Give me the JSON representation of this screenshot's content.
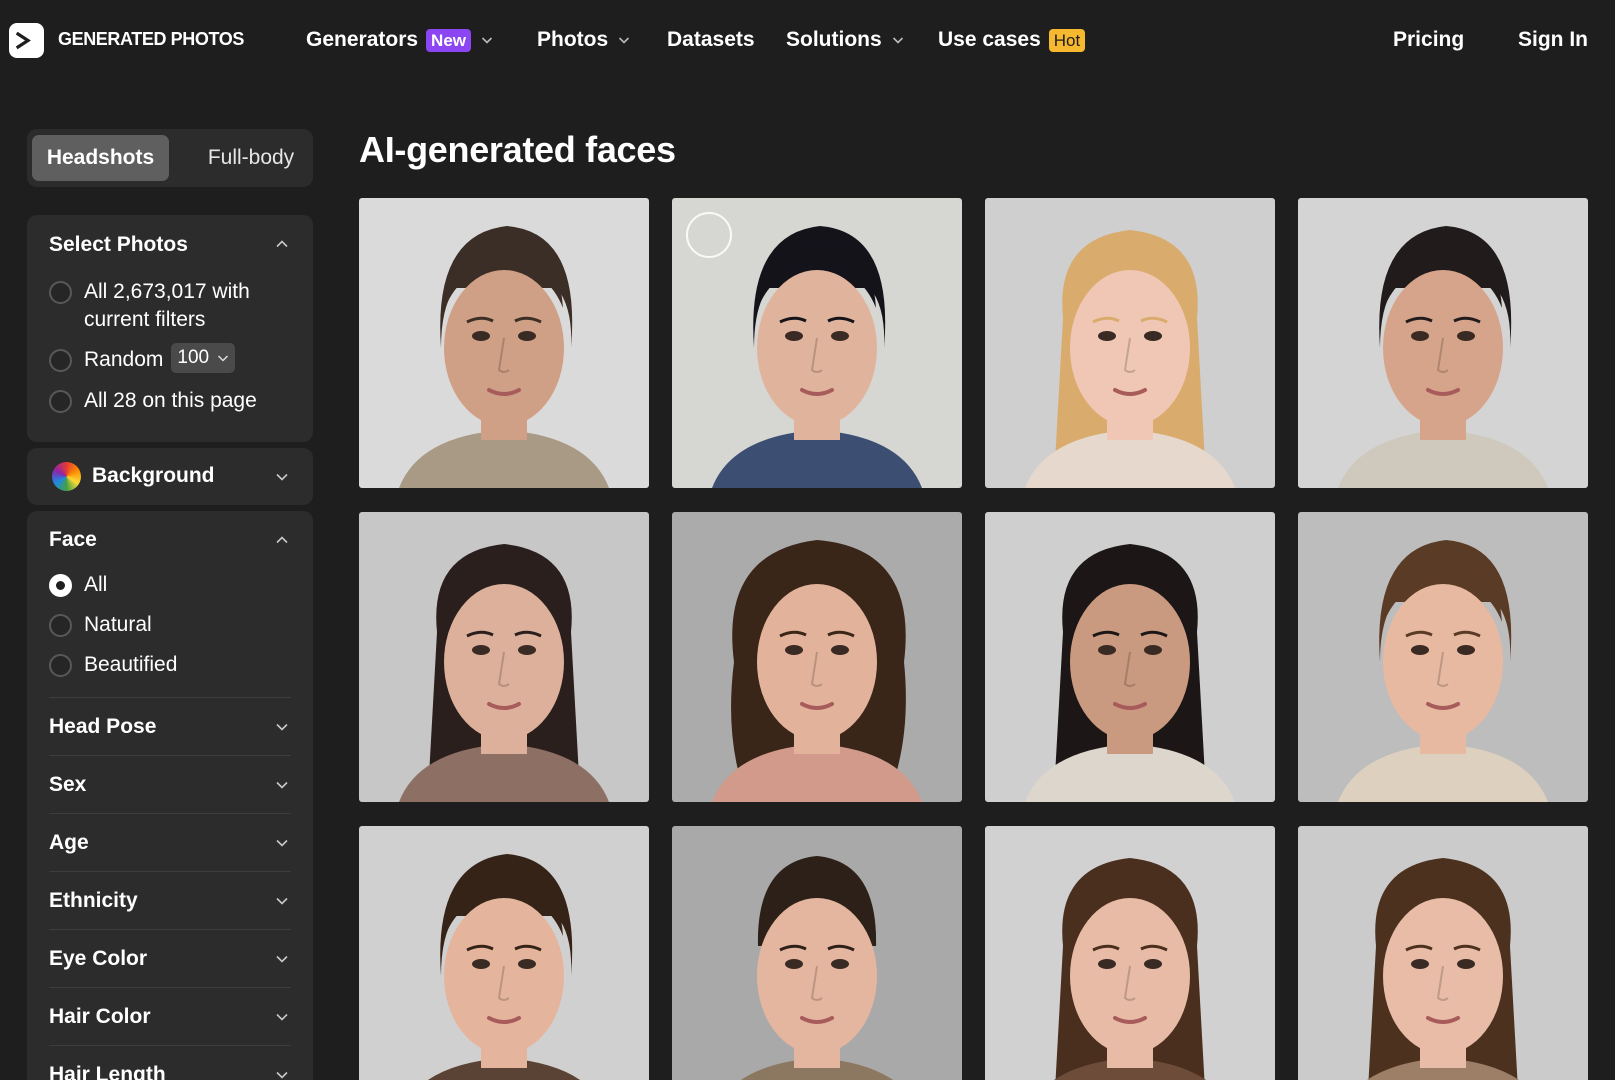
{
  "nav": {
    "brand": "GENERATED PHOTOS",
    "items": [
      {
        "label": "Generators",
        "badge": "New",
        "dropdown": true
      },
      {
        "label": "Photos",
        "badge": "",
        "dropdown": true
      },
      {
        "label": "Datasets",
        "badge": "",
        "dropdown": false
      },
      {
        "label": "Solutions",
        "badge": "",
        "dropdown": true
      },
      {
        "label": "Use cases",
        "badge": "Hot",
        "dropdown": false
      }
    ],
    "pricing": "Pricing",
    "sign_in": "Sign In",
    "logo_glyph": ">"
  },
  "sidebar": {
    "tabs": [
      "Headshots",
      "Full-body"
    ],
    "active_tab": "Headshots",
    "select_photos": {
      "title": "Select Photos",
      "opt_all": "All 2,673,017 with current filters",
      "opt_random": "Random",
      "random_count": "100",
      "opt_page": "All 28 on this page"
    },
    "background": {
      "title": "Background"
    },
    "face": {
      "title": "Face",
      "options": [
        "All",
        "Natural",
        "Beautified"
      ],
      "selected": "All"
    },
    "filters": [
      "Head Pose",
      "Sex",
      "Age",
      "Ethnicity",
      "Eye Color",
      "Hair Color",
      "Hair Length"
    ]
  },
  "main": {
    "title": "AI-generated faces",
    "photos": [
      {
        "name": "face-photo-1",
        "bg": "#dadada",
        "skin": "#cf9f86",
        "hair": "#3b2e26",
        "shirt": "#a89a84",
        "hair_style": "short"
      },
      {
        "name": "face-photo-2",
        "bg": "#d6d6d2",
        "skin": "#e0b49c",
        "hair": "#15131a",
        "shirt": "#3c4f72",
        "hair_style": "short"
      },
      {
        "name": "face-photo-3",
        "bg": "#cfcfcf",
        "skin": "#efc7b4",
        "hair": "#d9ac6e",
        "shirt": "#e6d8cc",
        "hair_style": "long"
      },
      {
        "name": "face-photo-4",
        "bg": "#d4d4d4",
        "skin": "#d6a48a",
        "hair": "#211c1b",
        "shirt": "#cfc9bd",
        "hair_style": "short"
      },
      {
        "name": "face-photo-5",
        "bg": "#c7c7c7",
        "skin": "#dcb09b",
        "hair": "#2a1f1c",
        "shirt": "#8d6f63",
        "hair_style": "long"
      },
      {
        "name": "face-photo-6",
        "bg": "#ababab",
        "skin": "#e2b29a",
        "hair": "#3a2519",
        "shirt": "#d29a8a",
        "hair_style": "curly"
      },
      {
        "name": "face-photo-7",
        "bg": "#cfcfcf",
        "skin": "#c99a7f",
        "hair": "#1c1716",
        "shirt": "#ddd6cc",
        "hair_style": "long"
      },
      {
        "name": "face-photo-8",
        "bg": "#bdbdbd",
        "skin": "#e7b9a1",
        "hair": "#5a3b26",
        "shirt": "#ddd0bf",
        "hair_style": "short"
      },
      {
        "name": "face-photo-9",
        "bg": "#d0d0d0",
        "skin": "#e4b59c",
        "hair": "#352318",
        "shirt": "#5a4335",
        "hair_style": "short"
      },
      {
        "name": "face-photo-10",
        "bg": "#a9a9a9",
        "skin": "#e5b69f",
        "hair": "#2d2019",
        "shirt": "#8c7760",
        "hair_style": "bun"
      },
      {
        "name": "face-photo-11",
        "bg": "#d1d1d1",
        "skin": "#e7bba5",
        "hair": "#4a2f1e",
        "shirt": "#6d4d3a",
        "hair_style": "long"
      },
      {
        "name": "face-photo-12",
        "bg": "#cbcbcb",
        "skin": "#e8bca6",
        "hair": "#4d311f",
        "shirt": "#9d7e66",
        "hair_style": "long"
      }
    ]
  }
}
